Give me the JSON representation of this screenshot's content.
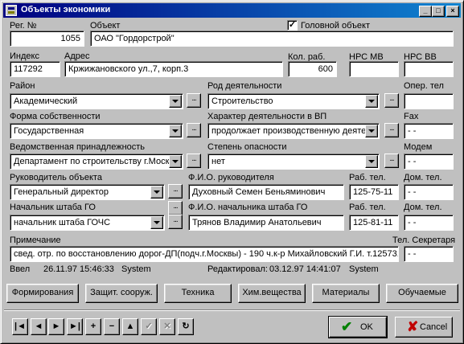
{
  "window": {
    "title": "Объекты экономики"
  },
  "labels": {
    "reg_no": "Рег. №",
    "object": "Объект",
    "head_object": "Головной объект",
    "index": "Индекс",
    "address": "Адрес",
    "workers": "Кол. раб.",
    "hrs_mv": "НРС МВ",
    "hrs_vv": "НРС ВВ",
    "district": "Район",
    "activity": "Род деятельности",
    "oper_tel": "Опер. тел",
    "ownership": "Форма собственности",
    "activity_char": "Характер деятельности в ВП",
    "fax": "Fax",
    "department": "Ведомственная принадлежность",
    "danger": "Степень опасности",
    "modem": "Модем",
    "manager": "Руководитель объекта",
    "manager_name": "Ф.И.О. руководителя",
    "work_tel": "Раб. тел.",
    "home_tel": "Дом. тел.",
    "go_chief": "Начальник штаба ГО",
    "go_chief_name": "Ф.И.О. начальника штаба ГО",
    "work_tel2": "Раб. тел.",
    "home_tel2": "Дом. тел.",
    "note": "Примечание",
    "secretary_tel": "Тел. Секретаря",
    "entered": "Ввел",
    "edited": "Редактировал:"
  },
  "fields": {
    "reg_no": "1055",
    "object": "ОАО \"Гордорстрой\"",
    "head_object_checked": true,
    "index": "117292",
    "address": "Кржижановского ул.,7, корп.3",
    "workers": "600",
    "hrs_mv": "",
    "hrs_vv": "",
    "district": "Академический",
    "activity": "Строительство",
    "oper_tel": "",
    "ownership": "Государственная",
    "activity_char": "продолжает производственную деятель",
    "fax": "- -",
    "department": "Департамент по строительству г.Москвы",
    "danger": "нет",
    "modem": "- -",
    "manager": "Генеральный директор",
    "manager_name": "Духовный Семен Беньяминович",
    "work_tel": "125-75-11",
    "home_tel": "- -",
    "go_chief": "начальник штаба ГОЧС",
    "go_chief_name": "Трянов Владимир Анатольевич",
    "work_tel2": "125-81-11",
    "home_tel2": "- -",
    "note": "свед. отр. по восстановлению дорог-ДП(подч.г.Москвы) - 190 ч.к-р Михайловский Г.И.  т.1257311",
    "secretary_tel": "- -"
  },
  "audit": {
    "entered_date": "26.11.97 15:46:33",
    "entered_user": "System",
    "edited_date": "03.12.97 14:41:07",
    "edited_user": "System"
  },
  "ellipsis": "...",
  "buttons": {
    "formations": "Формирования",
    "shelters": "Защит. сооруж.",
    "equipment": "Техника",
    "chemicals": "Хим.вещества",
    "materials": "Материалы",
    "training": "Обучаемые",
    "ok": "OK",
    "cancel": "Cancel"
  },
  "title_buttons": [
    "_",
    "□",
    "×"
  ],
  "navigator": [
    {
      "icon": "first-icon",
      "glyph": "|◄",
      "enabled": true
    },
    {
      "icon": "prior-icon",
      "glyph": "◄",
      "enabled": true
    },
    {
      "icon": "next-icon",
      "glyph": "►",
      "enabled": true
    },
    {
      "icon": "last-icon",
      "glyph": "►|",
      "enabled": true
    },
    {
      "icon": "insert-icon",
      "glyph": "+",
      "enabled": true
    },
    {
      "icon": "delete-icon",
      "glyph": "−",
      "enabled": true
    },
    {
      "icon": "edit-icon",
      "glyph": "▲",
      "enabled": true
    },
    {
      "icon": "post-icon",
      "glyph": "✓",
      "enabled": false
    },
    {
      "icon": "cancel-edit-icon",
      "glyph": "✕",
      "enabled": false
    },
    {
      "icon": "refresh-icon",
      "glyph": "↻",
      "enabled": true
    }
  ],
  "icons": {
    "ok": "✔",
    "cancel": "✘"
  },
  "colors": {
    "title_start": "#000080",
    "title_end": "#1084d0",
    "ok_check": "#008000",
    "cancel_x": "#c00000"
  }
}
